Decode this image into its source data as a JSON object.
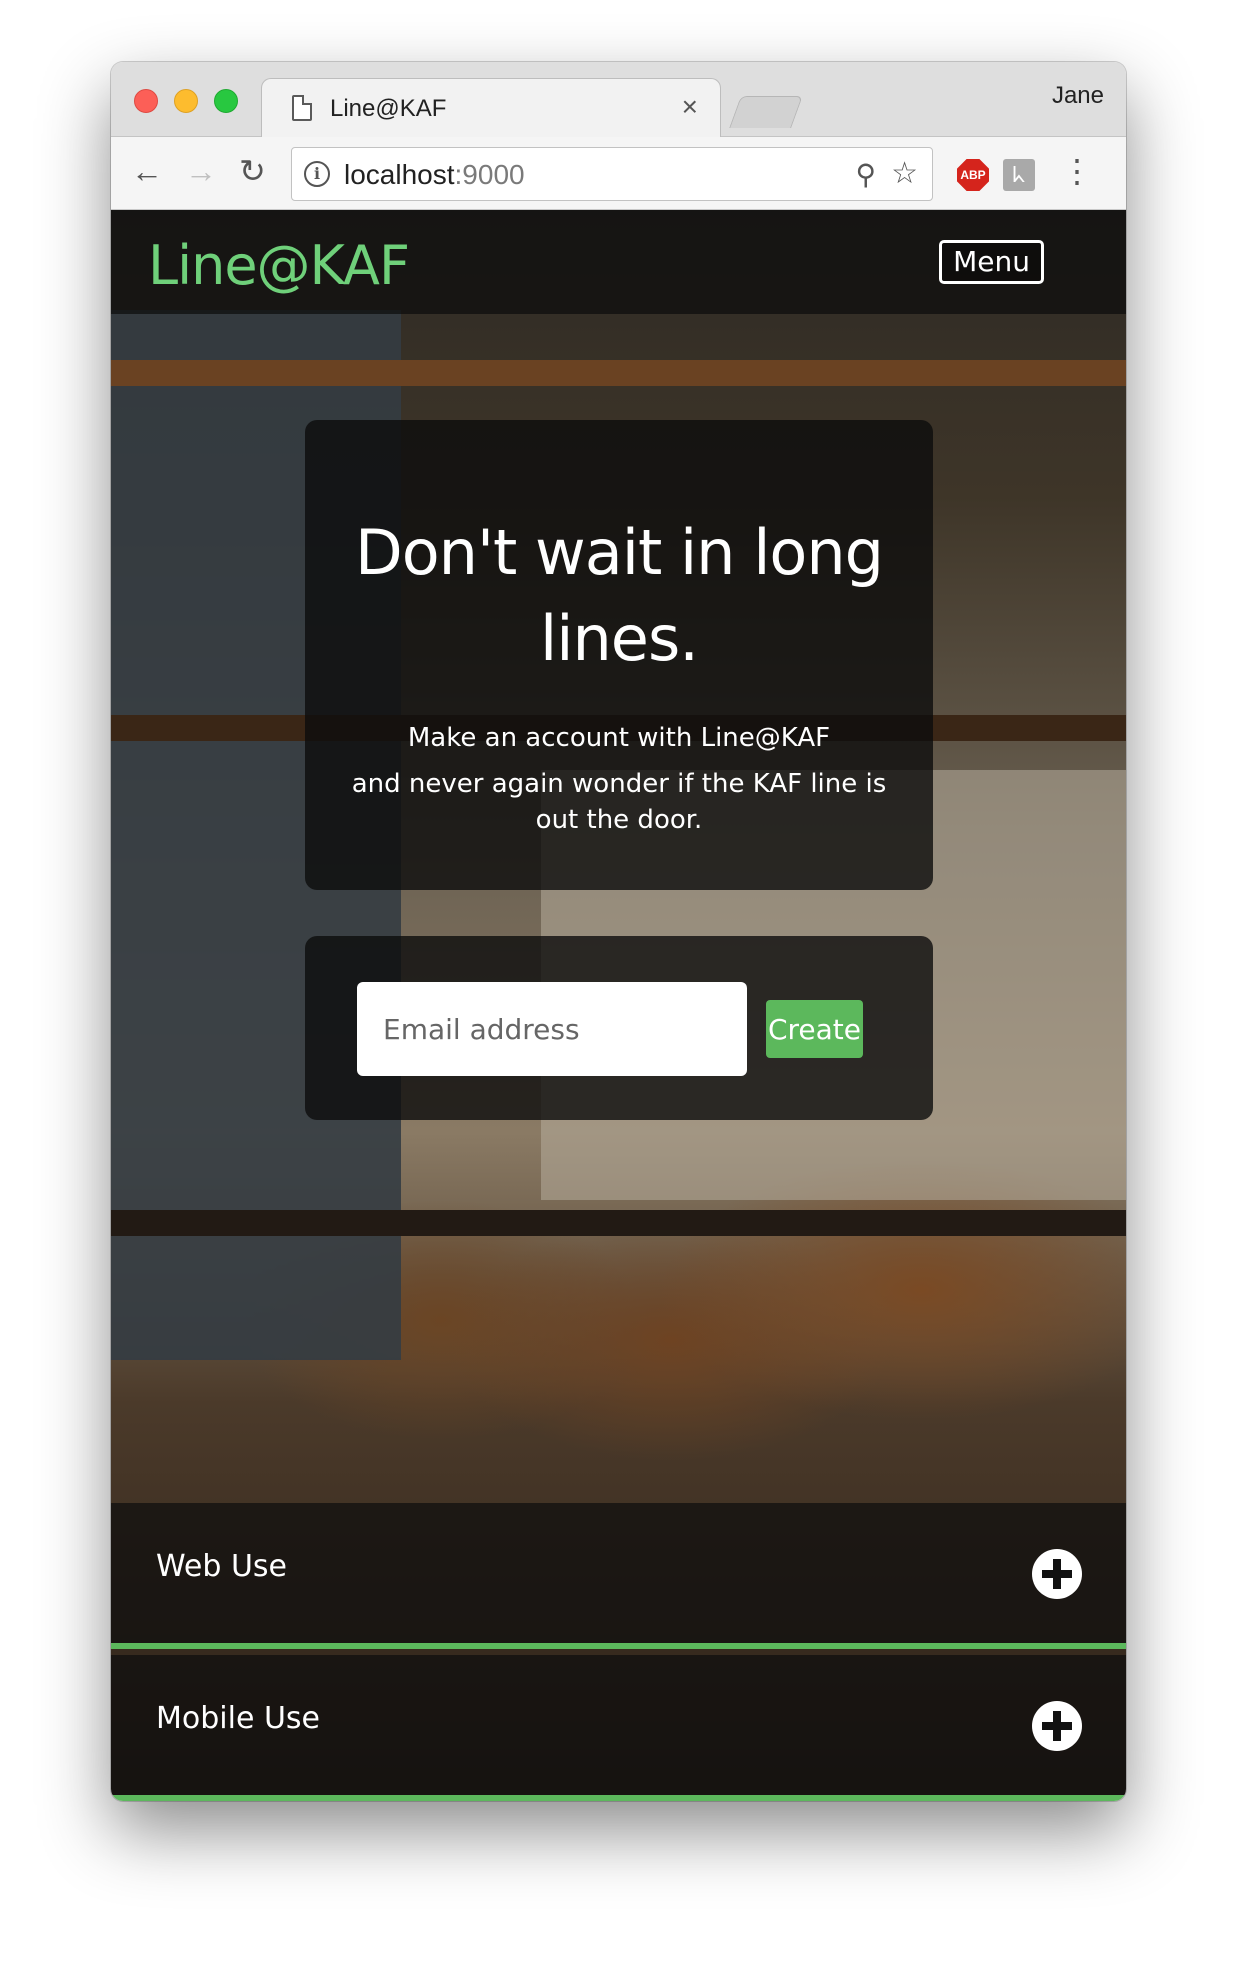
{
  "browser": {
    "tab_title": "Line@KAF",
    "tab_close": "×",
    "profile_name": "Jane",
    "url_host": "localhost",
    "url_port": ":9000",
    "icons": {
      "back": "←",
      "forward": "→",
      "reload": "↻",
      "info": "i",
      "zoom": "⚲",
      "star": "☆",
      "adblock": "ABP",
      "extension": "ᖾ",
      "menu": "⋮"
    }
  },
  "navbar": {
    "brand": "Line@KAF",
    "menu_label": "Menu"
  },
  "hero": {
    "title": "Don't wait in long lines.",
    "subtitle_line1": "Make an account with Line@KAF",
    "subtitle_line2": "and never again wonder if the KAF line is out the door."
  },
  "signup": {
    "email_placeholder": "Email address",
    "email_value": "",
    "create_label": "Create"
  },
  "accordion": [
    {
      "label": "Web Use"
    },
    {
      "label": "Mobile Use"
    }
  ],
  "colors": {
    "brand_green": "#6fd07a",
    "button_green": "#5cb85c",
    "overlay": "#0c0c0c"
  }
}
